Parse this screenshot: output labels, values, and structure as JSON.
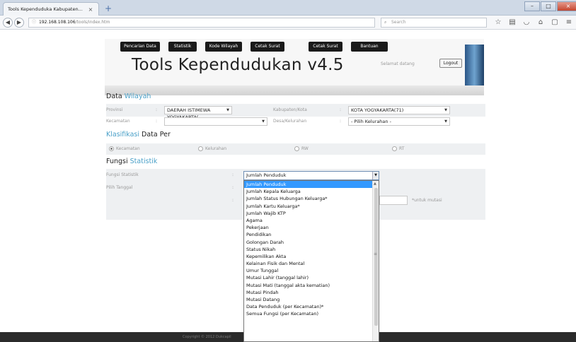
{
  "browser": {
    "tab_title": "Tools Kependuduka Kabupaten...",
    "tab_close": "×",
    "new_tab": "+",
    "url_host": "192.168.108.106",
    "url_path": "/tools/index.htm",
    "search_placeholder": "Search",
    "win_min": "–",
    "win_max": "□",
    "win_close": "×",
    "toolbar_icons": [
      "star-icon",
      "bookmark-list-icon",
      "pocket-icon",
      "home-icon",
      "menu-icon"
    ]
  },
  "header": {
    "menu": [
      "Pencarian Data",
      "Statistik",
      "Kode Wilayah",
      "Cetak Surat",
      "Cetak Surat",
      "Bantuan"
    ],
    "title": "Tools Kependudukan v4.5",
    "greeting": "Selamat datang",
    "logout": "Logout"
  },
  "data_wilayah": {
    "title_a": "Data ",
    "title_b": "Wilayah",
    "provinsi_label": "Provinsi",
    "provinsi_value": "DAERAH ISTIMEWA YOGYAKARTA(",
    "kabupaten_label": "Kabupaten/Kota",
    "kabupaten_value": "KOTA YOGYAKARTA(71)",
    "kecamatan_label": "Kecamatan",
    "kecamatan_value": "",
    "desa_label": "Desa/Kelurahan",
    "desa_value": "- Pilih Kelurahan -"
  },
  "klasifikasi": {
    "title_a": "Klasifikasi",
    "title_b": " Data Per",
    "options": [
      "Kecamatan",
      "Kelurahan",
      "RW",
      "RT"
    ],
    "selected": "Kecamatan"
  },
  "fungsi": {
    "title_a": "Fungsi ",
    "title_b": "Statistik",
    "fungsi_label": "Fungsi Statistik",
    "tanggal_label": "Pilih Tanggal",
    "selected_value": "Jumlah Penduduk",
    "note": "*untuk mutasi",
    "options": [
      "Jumlah Penduduk",
      "Jumlah Kepala Keluarga",
      "Jumlah Status Hubungan Keluarga*",
      "Jumlah Kartu Keluarga*",
      "Jumlah Wajib KTP",
      "Agama",
      "Pekerjaan",
      "Pendidikan",
      "Golongan Darah",
      "Status Nikah",
      "Kepemilikan Akta",
      "Kelainan Fisik dan Mental",
      "Umur Tunggal",
      "Mutasi Lahir (tanggal lahir)",
      "Mutasi Mati (tanggal akta kematian)",
      "Mutasi Pindah",
      "Mutasi Datang",
      "Data Penduduk (per Kecamatan)*",
      "Semua Fungsi (per Kecamatan)"
    ]
  },
  "footer": {
    "copyright": "Copyright © 2012 Dukcapil",
    "right_text": ""
  }
}
